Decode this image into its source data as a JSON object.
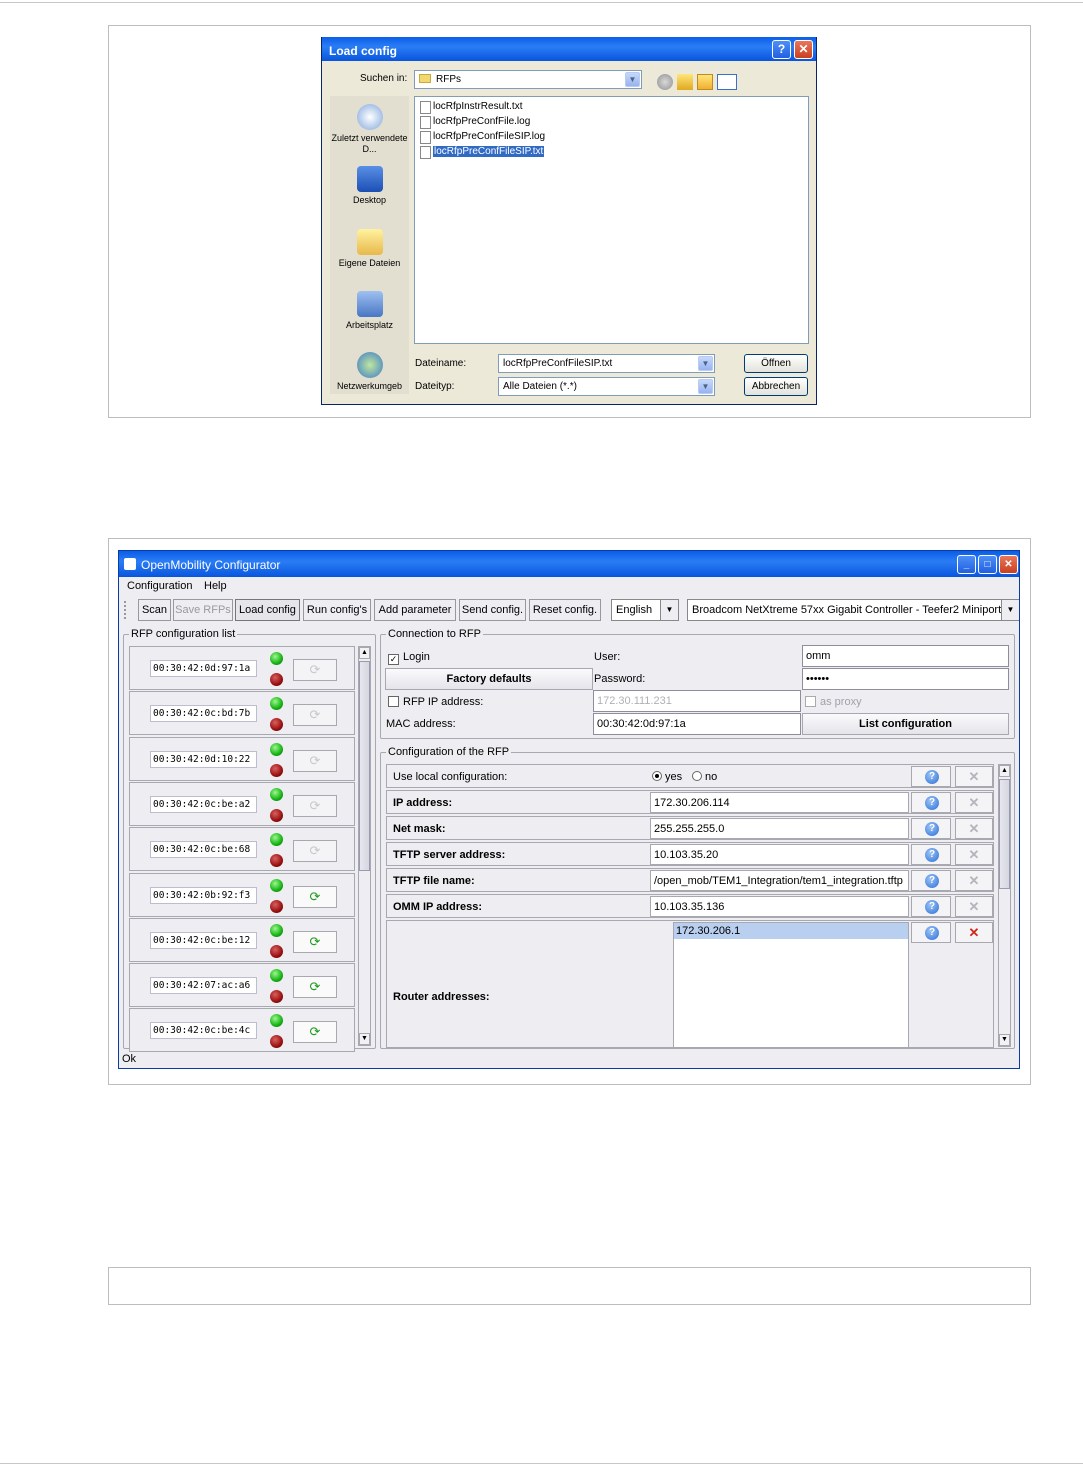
{
  "dialog": {
    "title": "Load config",
    "help_glyph": "?",
    "close_glyph": "✕",
    "look_in_label": "Suchen in:",
    "look_in_value": "RFPs",
    "places": [
      "Zuletzt verwendete D...",
      "Desktop",
      "Eigene Dateien",
      "Arbeitsplatz",
      "Netzwerkumgeb"
    ],
    "files": [
      "locRfpInstrResult.txt",
      "locRfpPreConfFile.log",
      "locRfpPreConfFileSIP.log",
      "locRfpPreConfFileSIP.txt"
    ],
    "selected_file": "locRfpPreConfFileSIP.txt",
    "filename_label": "Dateiname:",
    "filename_value": "locRfpPreConfFileSIP.txt",
    "filetype_label": "Dateityp:",
    "filetype_value": "Alle Dateien (*.*)",
    "open_button": "Öffnen",
    "cancel_button": "Abbrechen"
  },
  "app": {
    "title": "OpenMobility Configurator",
    "menu": [
      "Configuration",
      "Help"
    ],
    "toolbar": {
      "scan": "Scan",
      "save_rfps": "Save RFPs",
      "load_config": "Load config",
      "run_configs": "Run config's",
      "add_parameter": "Add parameter",
      "send_config": "Send config.",
      "reset_config": "Reset config."
    },
    "language": "English",
    "network_adapter": "Broadcom NetXtreme 57xx Gigabit Controller - Teefer2 Miniport",
    "rfp_list_title": "RFP configuration list",
    "rfps": [
      {
        "mac": "00:30:42:0d:97:1a",
        "action_enabled": false
      },
      {
        "mac": "00:30:42:0c:bd:7b",
        "action_enabled": false
      },
      {
        "mac": "00:30:42:0d:10:22",
        "action_enabled": false
      },
      {
        "mac": "00:30:42:0c:be:a2",
        "action_enabled": false
      },
      {
        "mac": "00:30:42:0c:be:68",
        "action_enabled": false
      },
      {
        "mac": "00:30:42:0b:92:f3",
        "action_enabled": true
      },
      {
        "mac": "00:30:42:0c:be:12",
        "action_enabled": true
      },
      {
        "mac": "00:30:42:07:ac:a6",
        "action_enabled": true
      },
      {
        "mac": "00:30:42:0c:be:4c",
        "action_enabled": true
      }
    ],
    "connection": {
      "title": "Connection to RFP",
      "login_label": "Login",
      "login_checked": true,
      "user_label": "User:",
      "user_value": "omm",
      "factory_defaults": "Factory defaults",
      "password_label": "Password:",
      "password_value": "••••••",
      "rfp_ip_label": "RFP IP address:",
      "rfp_ip_value": "172.30.111.231",
      "as_proxy_label": "as proxy",
      "mac_label": "MAC address:",
      "mac_value": "00:30:42:0d:97:1a",
      "list_configuration": "List configuration"
    },
    "config": {
      "title": "Configuration of the RFP",
      "use_local_label": "Use local configuration:",
      "yes": "yes",
      "no": "no",
      "rows": [
        {
          "label": "IP address:",
          "value": "172.30.206.114"
        },
        {
          "label": "Net mask:",
          "value": "255.255.255.0"
        },
        {
          "label": "TFTP server address:",
          "value": "10.103.35.20"
        },
        {
          "label": "TFTP file name:",
          "value": "/open_mob/TEM1_Integration/tem1_integration.tftp"
        },
        {
          "label": "OMM IP address:",
          "value": "10.103.35.136"
        }
      ],
      "router_label": "Router addresses:",
      "router_values": [
        "172.30.206.1"
      ]
    },
    "status": "Ok",
    "help_glyph": "?",
    "remove_glyph": "✕",
    "refresh_glyph": "⟳"
  }
}
